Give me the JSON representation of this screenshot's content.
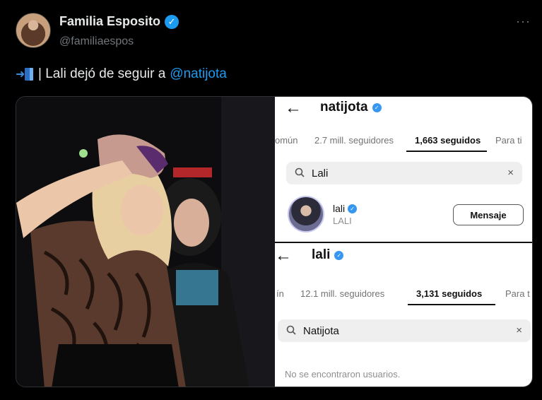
{
  "tweet": {
    "author_name": "Familia Esposito",
    "handle": "@familiaespos",
    "more": "···",
    "text_prefix": "| Lali dejó de seguir a ",
    "mention": "@natijota"
  },
  "ig_top": {
    "title": "natijota",
    "tabs": [
      "omún",
      "2.7 mill. seguidores",
      "1,663 seguidos",
      "Para ti"
    ],
    "active_tab": 2,
    "search_value": "Lali",
    "result": {
      "username": "lali",
      "fullname": "LALI",
      "button": "Mensaje"
    }
  },
  "ig_bottom": {
    "title": "lali",
    "tabs": [
      "ín",
      "12.1 mill. seguidores",
      "3,131 seguidos",
      "Para t"
    ],
    "active_tab": 2,
    "search_value": "Natijota",
    "empty_message": "No se encontraron usuarios."
  },
  "icons": {
    "back": "←",
    "search": "search-icon",
    "clear": "×",
    "verified": "✓"
  },
  "colors": {
    "background": "#000000",
    "twitter_blue": "#1d9bf0",
    "instagram_verified": "#3797f0"
  }
}
